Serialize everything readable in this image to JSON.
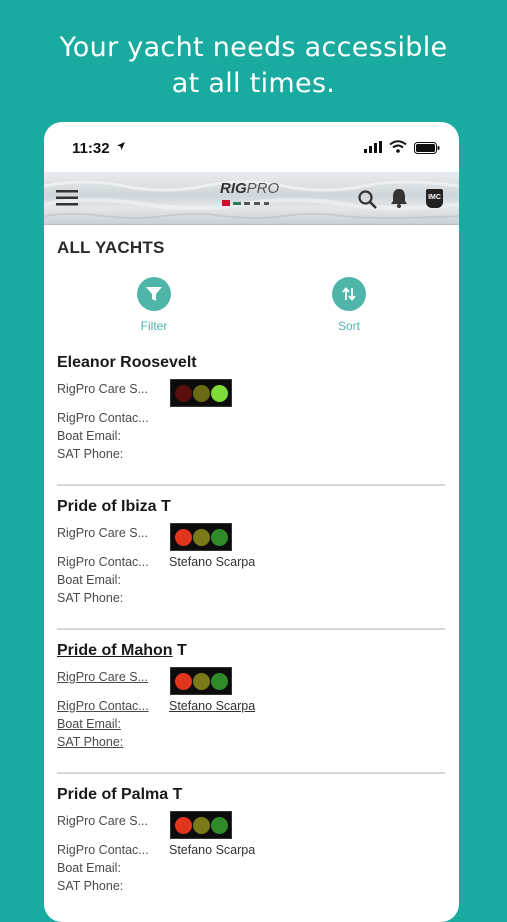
{
  "headline": {
    "line1": "Your yacht needs accessible",
    "line2": "at all times."
  },
  "status_bar": {
    "time": "11:32"
  },
  "app_bar": {
    "logo_text_bold": "RIG",
    "logo_text": "PRO",
    "badge": "IMC"
  },
  "page": {
    "title": "ALL YACHTS",
    "filter_label": "Filter",
    "sort_label": "Sort"
  },
  "labels": {
    "care": "RigPro Care S...",
    "contact": "RigPro Contac...",
    "email": "Boat Email:",
    "sat": "SAT Phone:"
  },
  "yachts": [
    {
      "name": "Eleanor Roosevelt",
      "suffix": "",
      "contact": "",
      "lights": [
        "#5a0f0f",
        "#6b6a14",
        "#7ddc3a"
      ]
    },
    {
      "name": "Pride of Ibiza",
      "suffix": "T",
      "contact": "Stefano Scarpa",
      "lights": [
        "#e0361e",
        "#7a7a18",
        "#2f8a2a"
      ]
    },
    {
      "name": "Pride of Mahon",
      "suffix": "T",
      "contact": "Stefano Scarpa",
      "lights": [
        "#e0361e",
        "#7a7a18",
        "#2f8a2a"
      ]
    },
    {
      "name": "Pride of Palma",
      "suffix": "T",
      "contact": "Stefano Scarpa",
      "lights": [
        "#e0361e",
        "#7a7a18",
        "#2f8a2a"
      ]
    }
  ],
  "colors": {
    "background": "#1aaba0",
    "accent": "#4fb5a8"
  },
  "icons": [
    "location-arrow-icon",
    "signal-icon",
    "wifi-icon",
    "battery-icon",
    "menu-icon",
    "search-icon",
    "bell-icon",
    "filter-icon",
    "sort-icon"
  ]
}
